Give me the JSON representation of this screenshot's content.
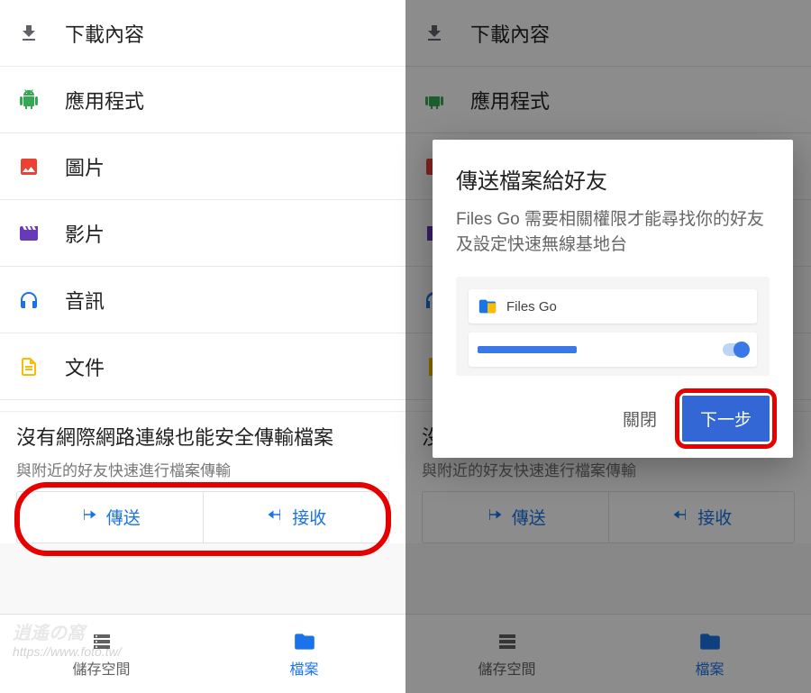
{
  "categories": [
    {
      "key": "downloads",
      "label": "下載內容",
      "icon": "download-icon",
      "color": "#5f6368"
    },
    {
      "key": "apps",
      "label": "應用程式",
      "icon": "android-icon",
      "color": "#34a853"
    },
    {
      "key": "images",
      "label": "圖片",
      "icon": "image-icon",
      "color": "#ea4335"
    },
    {
      "key": "videos",
      "label": "影片",
      "icon": "movie-icon",
      "color": "#673ab7"
    },
    {
      "key": "audio",
      "label": "音訊",
      "icon": "headphones-icon",
      "color": "#1a73e8"
    },
    {
      "key": "documents",
      "label": "文件",
      "icon": "document-icon",
      "color": "#fbbc04"
    }
  ],
  "transfer": {
    "title": "沒有網際網路連線也能安全傳輸檔案",
    "subtitle": "與附近的好友快速進行檔案傳輸",
    "send_label": "傳送",
    "receive_label": "接收"
  },
  "nav": {
    "storage_label": "儲存空間",
    "files_label": "檔案"
  },
  "dialog": {
    "title": "傳送檔案給好友",
    "body": "Files Go 需要相關權限才能尋找你的好友及設定快速無線基地台",
    "app_name": "Files Go",
    "close_label": "關閉",
    "next_label": "下一步"
  },
  "watermark": {
    "line1": "逍遙の窩",
    "line2": "https://www.foto.tw/"
  }
}
